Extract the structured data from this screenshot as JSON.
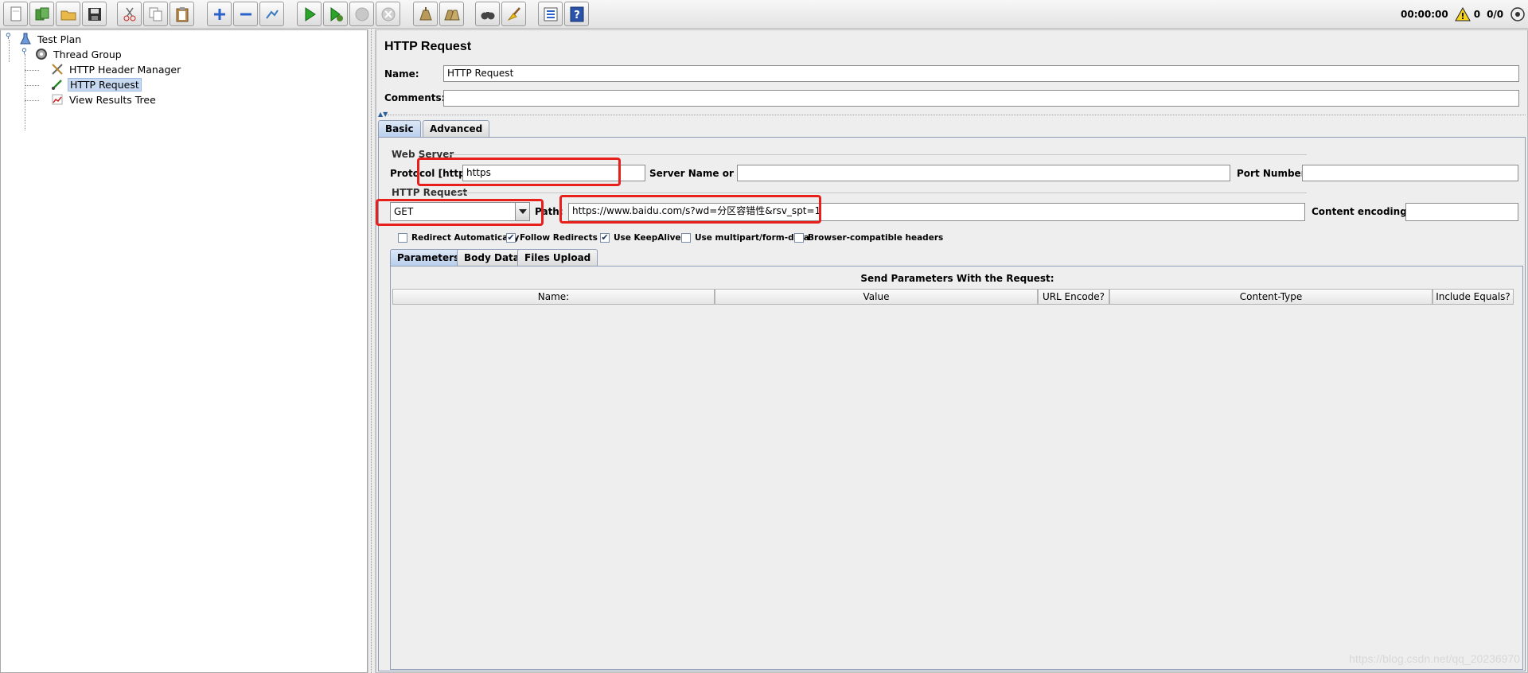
{
  "toolbar": {
    "buttons": [
      {
        "name": "new-icon"
      },
      {
        "name": "templates-icon"
      },
      {
        "name": "open-icon"
      },
      {
        "name": "save-icon"
      },
      {
        "name": "cut-icon"
      },
      {
        "name": "copy-icon"
      },
      {
        "name": "paste-icon"
      },
      {
        "name": "expand-icon"
      },
      {
        "name": "collapse-icon"
      },
      {
        "name": "toggle-icon"
      },
      {
        "name": "start-icon"
      },
      {
        "name": "start-no-pauses-icon"
      },
      {
        "name": "stop-icon"
      },
      {
        "name": "shutdown-icon"
      },
      {
        "name": "clear-icon"
      },
      {
        "name": "clear-all-icon"
      },
      {
        "name": "search-icon"
      },
      {
        "name": "reset-search-icon"
      },
      {
        "name": "function-helper-icon"
      },
      {
        "name": "help-icon"
      }
    ],
    "timer": "00:00:00",
    "warning_count": "0",
    "threads": "0/0"
  },
  "tree": {
    "items": [
      {
        "label": "Test Plan",
        "icon": "test-plan-icon"
      },
      {
        "label": "Thread Group",
        "icon": "thread-group-icon"
      },
      {
        "label": "HTTP Header Manager",
        "icon": "header-manager-icon"
      },
      {
        "label": "HTTP Request",
        "icon": "http-request-icon"
      },
      {
        "label": "View Results Tree",
        "icon": "results-tree-icon"
      }
    ]
  },
  "panel": {
    "title": "HTTP Request",
    "name_label": "Name:",
    "name_value": "HTTP Request",
    "comments_label": "Comments:",
    "comments_value": "",
    "tabs": [
      {
        "label": "Basic"
      },
      {
        "label": "Advanced"
      }
    ],
    "web_server": {
      "group_title": "Web Server",
      "protocol_label": "Protocol [http]:",
      "protocol_value": "https",
      "server_label": "Server Name or IP:",
      "server_value": "",
      "port_label": "Port Number:",
      "port_value": ""
    },
    "http_request": {
      "group_title": "HTTP Request",
      "method": "GET",
      "path_label": "Path:",
      "path_value": "https://www.baidu.com/s?wd=分区容错性&rsv_spt=1",
      "encoding_label": "Content encoding:",
      "encoding_value": ""
    },
    "checkboxes": [
      {
        "label": "Redirect Automatically",
        "checked": false
      },
      {
        "label": "Follow Redirects",
        "checked": true
      },
      {
        "label": "Use KeepAlive",
        "checked": true
      },
      {
        "label": "Use multipart/form-data",
        "checked": false
      },
      {
        "label": "Browser-compatible headers",
        "checked": false
      }
    ],
    "subtabs": [
      {
        "label": "Parameters"
      },
      {
        "label": "Body Data"
      },
      {
        "label": "Files Upload"
      }
    ],
    "params_caption": "Send Parameters With the Request:",
    "columns": [
      "Name:",
      "Value",
      "URL Encode?",
      "Content-Type",
      "Include Equals?"
    ]
  },
  "watermark": "https://blog.csdn.net/qq_20236970",
  "colors": {
    "highlight": "#e8201c",
    "selection": "#c7d9f1",
    "tab_active": "#b9cfec"
  }
}
